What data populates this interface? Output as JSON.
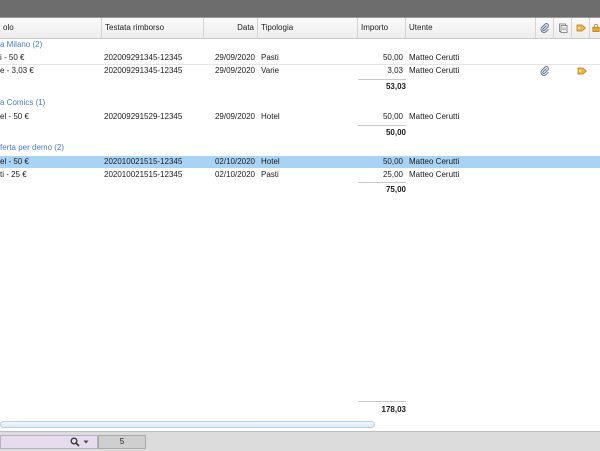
{
  "columns": {
    "titolo": "olo",
    "testata": "Testata rimborso",
    "data": "Data",
    "tipologia": "Tipologia",
    "importo": "Importo",
    "utente": "Utente"
  },
  "header_icons": [
    "attachment-icon",
    "document-icon",
    "tag-icon",
    "lock-icon"
  ],
  "groups": [
    {
      "label": "a Milano (2)",
      "rows": [
        {
          "titolo": "i - 50 €",
          "testata": "202009291345-12345",
          "data": "29/09/2020",
          "tipologia": "Pasti",
          "importo": "50,00",
          "utente": "Matteo Cerutti",
          "selected": false,
          "attach": false,
          "tag": false
        },
        {
          "titolo": "e - 3,03 €",
          "testata": "202009291345-12345",
          "data": "29/09/2020",
          "tipologia": "Varie",
          "importo": "3,03",
          "utente": "Matteo Cerutti",
          "selected": false,
          "attach": true,
          "tag": true
        }
      ],
      "total": "53,03"
    },
    {
      "label": "a Comics (1)",
      "rows": [
        {
          "titolo": "el - 50 €",
          "testata": "202009291529-12345",
          "data": "29/09/2020",
          "tipologia": "Hotel",
          "importo": "50,00",
          "utente": "Matteo Cerutti",
          "selected": false,
          "attach": false,
          "tag": false
        }
      ],
      "total": "50,00"
    },
    {
      "label": "ferta per demo (2)",
      "rows": [
        {
          "titolo": "el - 50 €",
          "testata": "202010021515-12345",
          "data": "02/10/2020",
          "tipologia": "Hotel",
          "importo": "50,00",
          "utente": "Matteo Cerutti",
          "selected": true,
          "attach": false,
          "tag": false
        },
        {
          "titolo": "ti - 25 €",
          "testata": "202010021515-12345",
          "data": "02/10/2020",
          "tipologia": "Pasti",
          "importo": "25,00",
          "utente": "Matteo Cerutti",
          "selected": false,
          "attach": false,
          "tag": false
        }
      ],
      "total": "75,00"
    }
  ],
  "grand_total": "178,03",
  "footer": {
    "search_value": "",
    "count": "5"
  },
  "colors": {
    "selected_row": "#a9d3f5",
    "group_text": "#4a7bbf"
  }
}
